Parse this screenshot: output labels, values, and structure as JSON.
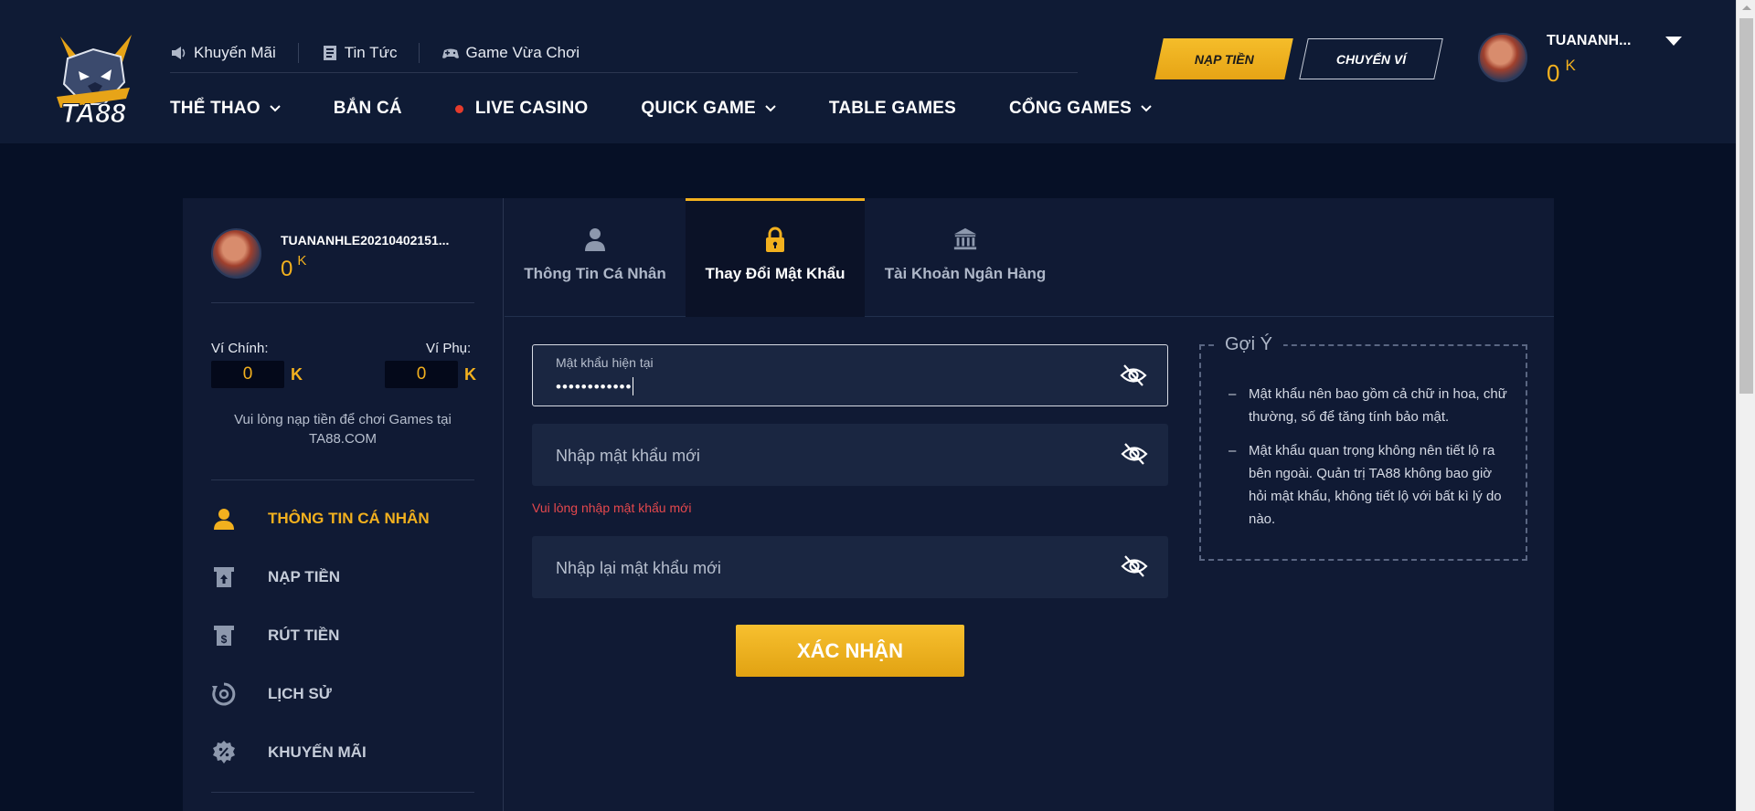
{
  "header": {
    "logo_text": "TA88",
    "top_links": [
      {
        "icon": "megaphone-icon",
        "label": "Khuyến Mãi"
      },
      {
        "icon": "news-icon",
        "label": "Tin Tức"
      },
      {
        "icon": "gamepad-icon",
        "label": "Game Vừa Chơi"
      }
    ],
    "nav": [
      {
        "label": "THỂ THAO",
        "dropdown": true
      },
      {
        "label": "BẮN CÁ",
        "dropdown": false
      },
      {
        "label": "LIVE CASINO",
        "dropdown": false,
        "live_dot": true
      },
      {
        "label": "QUICK GAME",
        "dropdown": true
      },
      {
        "label": "TABLE GAMES",
        "dropdown": false
      },
      {
        "label": "CỔNG GAMES",
        "dropdown": true
      }
    ],
    "deposit_button": "NẠP TIỀN",
    "transfer_button": "CHUYỂN VÍ",
    "username": "TUANANH...",
    "balance": "0",
    "balance_unit": "K"
  },
  "sidebar": {
    "username": "TUANANHLE20210402151...",
    "balance": "0",
    "balance_unit": "K",
    "main_wallet_label": "Ví Chính:",
    "main_wallet_value": "0",
    "main_wallet_unit": "K",
    "sub_wallet_label": "Ví Phụ:",
    "sub_wallet_value": "0",
    "sub_wallet_unit": "K",
    "note": "Vui lòng nạp tiền để chơi Games tại TA88.COM",
    "menu": [
      {
        "label": "THÔNG TIN CÁ NHÂN",
        "icon": "user-icon",
        "active": true
      },
      {
        "label": "NẠP TIỀN",
        "icon": "deposit-icon",
        "active": false
      },
      {
        "label": "RÚT TIỀN",
        "icon": "withdraw-icon",
        "active": false
      },
      {
        "label": "LỊCH SỬ",
        "icon": "history-icon",
        "active": false
      },
      {
        "label": "KHUYẾN MÃI",
        "icon": "promotion-icon",
        "active": false
      }
    ]
  },
  "tabs": [
    {
      "label": "Thông Tin Cá Nhân",
      "icon": "user-icon",
      "active": false
    },
    {
      "label": "Thay Đổi Mật Khẩu",
      "icon": "lock-icon",
      "active": true
    },
    {
      "label": "Tài Khoản Ngân Hàng",
      "icon": "bank-icon",
      "active": false
    }
  ],
  "form": {
    "current_password_label": "Mật khẩu hiện tại",
    "current_password_value": "••••••••••••",
    "new_password_placeholder": "Nhập mật khẩu mới",
    "new_password_error": "Vui lòng nhập mật khẩu mới",
    "confirm_password_placeholder": "Nhập lại mật khẩu mới",
    "submit_label": "XÁC NHẬN"
  },
  "hint": {
    "title": "Gợi Ý",
    "items": [
      "Mật khẩu nên bao gồm cả chữ in hoa, chữ thường, số để tăng tính bảo mật.",
      "Mật khẩu quan trọng không nên tiết lộ ra bên ngoài. Quản trị TA88 không bao giờ hỏi mật khẩu, không tiết lộ với bất kì lý do nào."
    ]
  },
  "colors": {
    "accent": "#f2b01e",
    "header_bg": "#0f1b35",
    "page_bg": "#061026",
    "panel_bg": "#101a34",
    "error": "#e5484d"
  }
}
